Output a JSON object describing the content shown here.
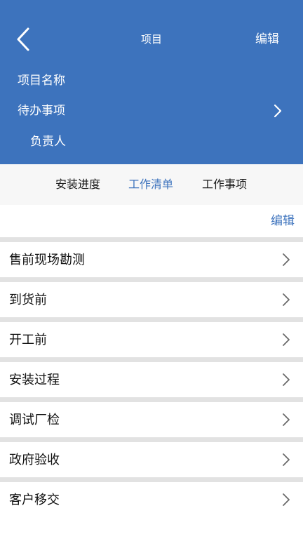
{
  "header": {
    "title": "项目",
    "edit_label": "编辑",
    "project_name_label": "项目名称",
    "todo_label": "待办事项",
    "owner_label": "负责人"
  },
  "tabs": [
    {
      "label": "安装进度",
      "active": false
    },
    {
      "label": "工作清单",
      "active": true
    },
    {
      "label": "工作事项",
      "active": false
    }
  ],
  "toolbar": {
    "edit_label": "编辑"
  },
  "stages": [
    {
      "label": "售前现场勘测"
    },
    {
      "label": "到货前"
    },
    {
      "label": "开工前"
    },
    {
      "label": "安装过程"
    },
    {
      "label": "调试厂检"
    },
    {
      "label": "政府验收"
    },
    {
      "label": "客户移交"
    }
  ],
  "colors": {
    "brand": "#3d73bd",
    "tab_bar_bg": "#f7f7f7",
    "divider": "#e2e2e2"
  },
  "icons": {
    "back": "chevron-left-icon",
    "todo_arrow": "chevron-right-icon",
    "row_arrow": "chevron-right-icon"
  }
}
